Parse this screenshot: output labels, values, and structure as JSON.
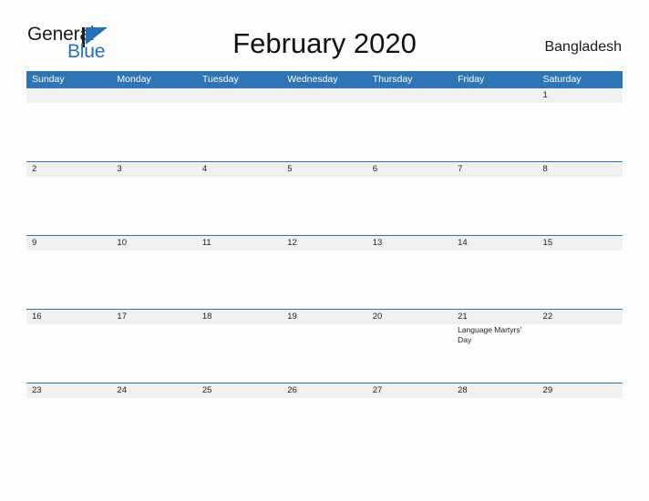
{
  "brand": {
    "name_part1": "General",
    "name_part2": "Blue",
    "flag_icon": "flag-triangle-icon",
    "accent_color": "#2472b8"
  },
  "header": {
    "title": "February 2020",
    "country": "Bangladesh"
  },
  "theme": {
    "header_blue": "#2e75b6",
    "row_gray": "#f0f0f0",
    "page_background": "#fdfdfd",
    "text_color": "#1f1f1f"
  },
  "calendar": {
    "month": "February",
    "year": "2020",
    "weekday_headers": [
      "Sunday",
      "Monday",
      "Tuesday",
      "Wednesday",
      "Thursday",
      "Friday",
      "Saturday"
    ],
    "weeks": [
      {
        "days": [
          {
            "num": "",
            "events": []
          },
          {
            "num": "",
            "events": []
          },
          {
            "num": "",
            "events": []
          },
          {
            "num": "",
            "events": []
          },
          {
            "num": "",
            "events": []
          },
          {
            "num": "",
            "events": []
          },
          {
            "num": "1",
            "events": []
          }
        ]
      },
      {
        "days": [
          {
            "num": "2",
            "events": []
          },
          {
            "num": "3",
            "events": []
          },
          {
            "num": "4",
            "events": []
          },
          {
            "num": "5",
            "events": []
          },
          {
            "num": "6",
            "events": []
          },
          {
            "num": "7",
            "events": []
          },
          {
            "num": "8",
            "events": []
          }
        ]
      },
      {
        "days": [
          {
            "num": "9",
            "events": []
          },
          {
            "num": "10",
            "events": []
          },
          {
            "num": "11",
            "events": []
          },
          {
            "num": "12",
            "events": []
          },
          {
            "num": "13",
            "events": []
          },
          {
            "num": "14",
            "events": []
          },
          {
            "num": "15",
            "events": []
          }
        ]
      },
      {
        "days": [
          {
            "num": "16",
            "events": []
          },
          {
            "num": "17",
            "events": []
          },
          {
            "num": "18",
            "events": []
          },
          {
            "num": "19",
            "events": []
          },
          {
            "num": "20",
            "events": []
          },
          {
            "num": "21",
            "events": [
              "Language Martyrs' Day"
            ]
          },
          {
            "num": "22",
            "events": []
          }
        ]
      },
      {
        "days": [
          {
            "num": "23",
            "events": []
          },
          {
            "num": "24",
            "events": []
          },
          {
            "num": "25",
            "events": []
          },
          {
            "num": "26",
            "events": []
          },
          {
            "num": "27",
            "events": []
          },
          {
            "num": "28",
            "events": []
          },
          {
            "num": "29",
            "events": []
          }
        ]
      }
    ]
  }
}
